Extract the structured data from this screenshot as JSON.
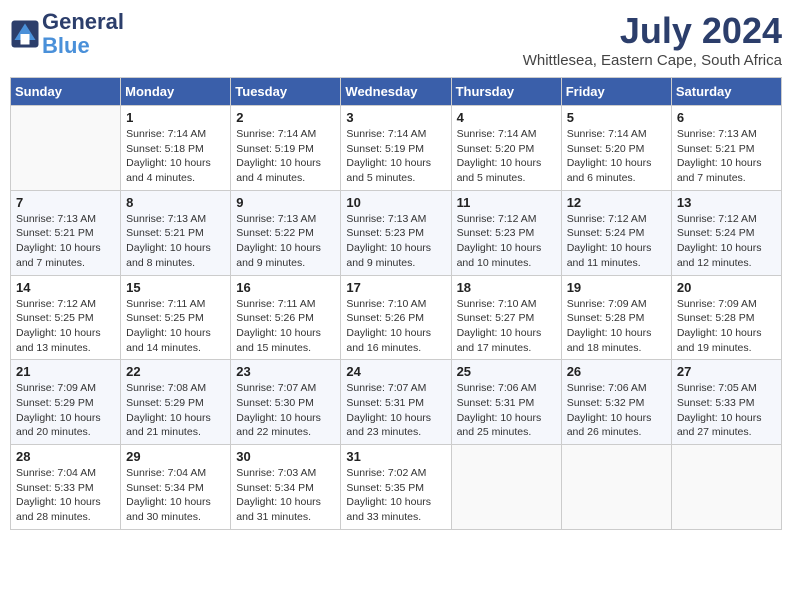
{
  "header": {
    "logo_text_general": "General",
    "logo_text_blue": "Blue",
    "month_title": "July 2024",
    "location": "Whittlesea, Eastern Cape, South Africa"
  },
  "weekdays": [
    "Sunday",
    "Monday",
    "Tuesday",
    "Wednesday",
    "Thursday",
    "Friday",
    "Saturday"
  ],
  "weeks": [
    [
      {
        "day": "",
        "info": ""
      },
      {
        "day": "1",
        "info": "Sunrise: 7:14 AM\nSunset: 5:18 PM\nDaylight: 10 hours\nand 4 minutes."
      },
      {
        "day": "2",
        "info": "Sunrise: 7:14 AM\nSunset: 5:19 PM\nDaylight: 10 hours\nand 4 minutes."
      },
      {
        "day": "3",
        "info": "Sunrise: 7:14 AM\nSunset: 5:19 PM\nDaylight: 10 hours\nand 5 minutes."
      },
      {
        "day": "4",
        "info": "Sunrise: 7:14 AM\nSunset: 5:20 PM\nDaylight: 10 hours\nand 5 minutes."
      },
      {
        "day": "5",
        "info": "Sunrise: 7:14 AM\nSunset: 5:20 PM\nDaylight: 10 hours\nand 6 minutes."
      },
      {
        "day": "6",
        "info": "Sunrise: 7:13 AM\nSunset: 5:21 PM\nDaylight: 10 hours\nand 7 minutes."
      }
    ],
    [
      {
        "day": "7",
        "info": "Sunrise: 7:13 AM\nSunset: 5:21 PM\nDaylight: 10 hours\nand 7 minutes."
      },
      {
        "day": "8",
        "info": "Sunrise: 7:13 AM\nSunset: 5:21 PM\nDaylight: 10 hours\nand 8 minutes."
      },
      {
        "day": "9",
        "info": "Sunrise: 7:13 AM\nSunset: 5:22 PM\nDaylight: 10 hours\nand 9 minutes."
      },
      {
        "day": "10",
        "info": "Sunrise: 7:13 AM\nSunset: 5:23 PM\nDaylight: 10 hours\nand 9 minutes."
      },
      {
        "day": "11",
        "info": "Sunrise: 7:12 AM\nSunset: 5:23 PM\nDaylight: 10 hours\nand 10 minutes."
      },
      {
        "day": "12",
        "info": "Sunrise: 7:12 AM\nSunset: 5:24 PM\nDaylight: 10 hours\nand 11 minutes."
      },
      {
        "day": "13",
        "info": "Sunrise: 7:12 AM\nSunset: 5:24 PM\nDaylight: 10 hours\nand 12 minutes."
      }
    ],
    [
      {
        "day": "14",
        "info": "Sunrise: 7:12 AM\nSunset: 5:25 PM\nDaylight: 10 hours\nand 13 minutes."
      },
      {
        "day": "15",
        "info": "Sunrise: 7:11 AM\nSunset: 5:25 PM\nDaylight: 10 hours\nand 14 minutes."
      },
      {
        "day": "16",
        "info": "Sunrise: 7:11 AM\nSunset: 5:26 PM\nDaylight: 10 hours\nand 15 minutes."
      },
      {
        "day": "17",
        "info": "Sunrise: 7:10 AM\nSunset: 5:26 PM\nDaylight: 10 hours\nand 16 minutes."
      },
      {
        "day": "18",
        "info": "Sunrise: 7:10 AM\nSunset: 5:27 PM\nDaylight: 10 hours\nand 17 minutes."
      },
      {
        "day": "19",
        "info": "Sunrise: 7:09 AM\nSunset: 5:28 PM\nDaylight: 10 hours\nand 18 minutes."
      },
      {
        "day": "20",
        "info": "Sunrise: 7:09 AM\nSunset: 5:28 PM\nDaylight: 10 hours\nand 19 minutes."
      }
    ],
    [
      {
        "day": "21",
        "info": "Sunrise: 7:09 AM\nSunset: 5:29 PM\nDaylight: 10 hours\nand 20 minutes."
      },
      {
        "day": "22",
        "info": "Sunrise: 7:08 AM\nSunset: 5:29 PM\nDaylight: 10 hours\nand 21 minutes."
      },
      {
        "day": "23",
        "info": "Sunrise: 7:07 AM\nSunset: 5:30 PM\nDaylight: 10 hours\nand 22 minutes."
      },
      {
        "day": "24",
        "info": "Sunrise: 7:07 AM\nSunset: 5:31 PM\nDaylight: 10 hours\nand 23 minutes."
      },
      {
        "day": "25",
        "info": "Sunrise: 7:06 AM\nSunset: 5:31 PM\nDaylight: 10 hours\nand 25 minutes."
      },
      {
        "day": "26",
        "info": "Sunrise: 7:06 AM\nSunset: 5:32 PM\nDaylight: 10 hours\nand 26 minutes."
      },
      {
        "day": "27",
        "info": "Sunrise: 7:05 AM\nSunset: 5:33 PM\nDaylight: 10 hours\nand 27 minutes."
      }
    ],
    [
      {
        "day": "28",
        "info": "Sunrise: 7:04 AM\nSunset: 5:33 PM\nDaylight: 10 hours\nand 28 minutes."
      },
      {
        "day": "29",
        "info": "Sunrise: 7:04 AM\nSunset: 5:34 PM\nDaylight: 10 hours\nand 30 minutes."
      },
      {
        "day": "30",
        "info": "Sunrise: 7:03 AM\nSunset: 5:34 PM\nDaylight: 10 hours\nand 31 minutes."
      },
      {
        "day": "31",
        "info": "Sunrise: 7:02 AM\nSunset: 5:35 PM\nDaylight: 10 hours\nand 33 minutes."
      },
      {
        "day": "",
        "info": ""
      },
      {
        "day": "",
        "info": ""
      },
      {
        "day": "",
        "info": ""
      }
    ]
  ]
}
